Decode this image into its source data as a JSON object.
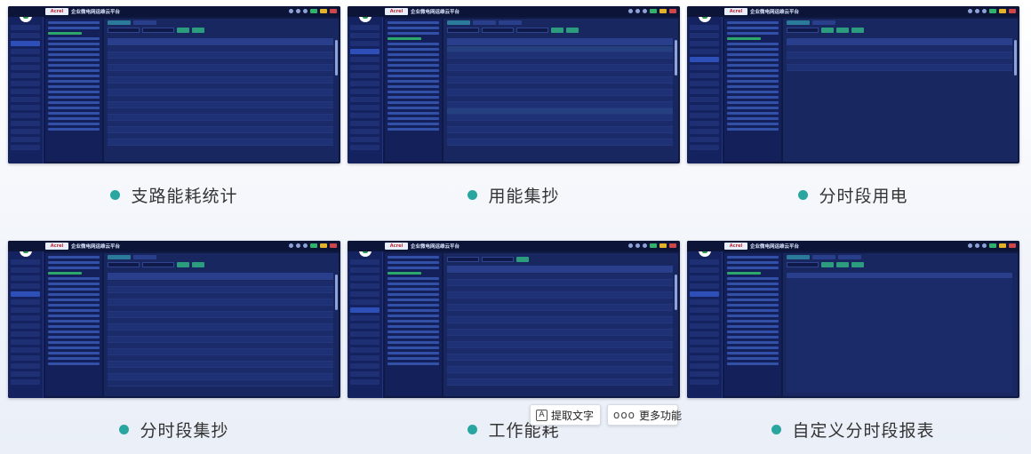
{
  "screenshots": {
    "logo_text": "Acrel",
    "app_title": "企业微电网运维云平台"
  },
  "cards": [
    {
      "caption": "支路能耗统计"
    },
    {
      "caption": "用能集抄"
    },
    {
      "caption": "分时段用电"
    },
    {
      "caption": "分时段集抄"
    },
    {
      "caption": "工作能耗"
    },
    {
      "caption": "自定义分时段报表"
    }
  ],
  "popup": {
    "extract_text_label": "提取文字",
    "more_label": "更多功能",
    "extract_icon": "A",
    "more_icon": "ooo"
  },
  "colors": {
    "bullet": "#2aa6a0",
    "screen_bg": "#0f1a44",
    "accent_green": "#2c9c7e"
  }
}
